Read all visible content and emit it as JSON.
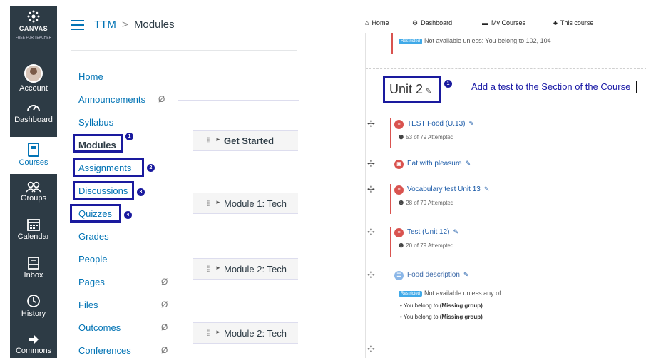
{
  "canvas": {
    "logo_text": "CANVAS",
    "logo_sub": "FREE FOR TEACHER",
    "global_nav": [
      {
        "label": "Account",
        "icon": "avatar"
      },
      {
        "label": "Dashboard",
        "icon": "dashboard-icon"
      },
      {
        "label": "Courses",
        "icon": "courses-icon",
        "active": true
      },
      {
        "label": "Groups",
        "icon": "groups-icon"
      },
      {
        "label": "Calendar",
        "icon": "calendar-icon"
      },
      {
        "label": "Inbox",
        "icon": "inbox-icon"
      },
      {
        "label": "History",
        "icon": "history-icon"
      },
      {
        "label": "Commons",
        "icon": "commons-icon"
      }
    ],
    "breadcrumb": {
      "course": "TTM",
      "separator": ">",
      "current": "Modules"
    },
    "course_nav": [
      {
        "label": "Home"
      },
      {
        "label": "Announcements",
        "hidden": true
      },
      {
        "label": "Syllabus"
      },
      {
        "label": "Modules",
        "active": true,
        "callout": "1"
      },
      {
        "label": "Assignments",
        "callout": "2"
      },
      {
        "label": "Discussions",
        "callout": "3"
      },
      {
        "label": "Quizzes",
        "callout": "4"
      },
      {
        "label": "Grades"
      },
      {
        "label": "People"
      },
      {
        "label": "Pages",
        "hidden": true
      },
      {
        "label": "Files",
        "hidden": true
      },
      {
        "label": "Outcomes",
        "hidden": true
      },
      {
        "label": "Conferences",
        "hidden": true
      }
    ],
    "hidden_icon": "Ø",
    "modules": [
      {
        "title": "Get Started"
      },
      {
        "title": "Module 1: Tech"
      },
      {
        "title": "Module 2: Tech"
      },
      {
        "title": "Module 2: Tech"
      }
    ]
  },
  "moodle": {
    "nav": [
      {
        "label": "Home",
        "icon": "home-icon"
      },
      {
        "label": "Dashboard",
        "icon": "dashboard-icon"
      },
      {
        "label": "My Courses",
        "icon": "courses-icon"
      },
      {
        "label": "This course",
        "icon": "course-tree-icon"
      }
    ],
    "restricted_tag": "Restricted",
    "top_restriction": "Not available unless: You belong to 102, 104",
    "unit_title": "Unit 2",
    "unit_callout": "1",
    "note": "Add a test to the Section of the Course",
    "activities": [
      {
        "name": "TEST Food (U.13)",
        "attempted": "53 of 79 Attempted",
        "type": "quiz"
      },
      {
        "name": "Eat with pleasure",
        "attempted": "",
        "type": "assignment"
      },
      {
        "name": "Vocabulary test Unit 13",
        "attempted": "28 of 79 Attempted",
        "type": "quiz"
      },
      {
        "name": "Test (Unit 12)",
        "attempted": "20 of 79 Attempted",
        "type": "quiz"
      },
      {
        "name": "Food description",
        "attempted": "",
        "type": "forum"
      }
    ],
    "food_restriction": "Not available unless any of:",
    "food_bullets": [
      {
        "prefix": "You belong to ",
        "group": "(Missing group)"
      },
      {
        "prefix": "You belong to ",
        "group": "(Missing group)"
      }
    ]
  }
}
